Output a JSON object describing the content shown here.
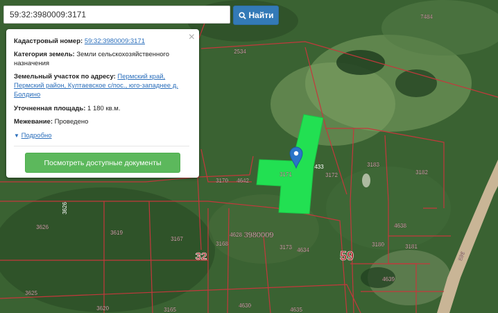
{
  "search": {
    "value": "59:32:3980009:3171",
    "button_label": "Найти"
  },
  "popup": {
    "cadastral_label": "Кадастровый номер:",
    "cadastral_value": "59:32:3980009:3171",
    "category_label": "Категория земель:",
    "category_value": "Земли сельскохозяйственного назначения",
    "address_label": "Земельный участок по адресу:",
    "address_value": "Пермский край, Пермский район, Култаевское с/пос., юго-западнее д. Болдино",
    "area_label": "Уточненная площадь:",
    "area_value": "1 180 кв.м.",
    "survey_label": "Межевание:",
    "survey_value": "Проведено",
    "more_label": "Подробно",
    "docs_button": "Посмотреть доступные документы",
    "close": "×"
  },
  "map": {
    "parcel_labels": [
      "7484",
      "2534",
      "3170",
      "4642",
      "3171",
      "3172",
      "3183",
      "3182",
      "3626",
      "3619",
      "3167",
      "3168",
      "4628",
      "3980009",
      "3173",
      "4634",
      "3180",
      "3181",
      "4638",
      "3625",
      "3620",
      "3165",
      "4630",
      "4635",
      "4639",
      "596"
    ],
    "district_labels": [
      "32",
      "59"
    ],
    "colors": {
      "selected_parcel": "#22e052",
      "parcel_border": "#c4383c",
      "marker": "#2a74c8",
      "road": "#c9b596"
    }
  }
}
